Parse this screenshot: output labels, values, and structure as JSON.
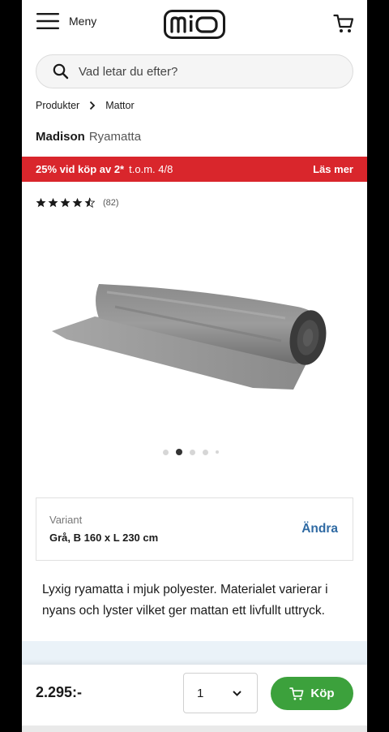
{
  "header": {
    "menu_label": "Meny",
    "logo_text": "mio",
    "icons": [
      "hamburger-menu-icon",
      "cart-icon"
    ]
  },
  "search": {
    "placeholder": "Vad letar du efter?",
    "icon": "search-icon"
  },
  "breadcrumb": {
    "items": [
      "Produkter",
      "Mattor"
    ]
  },
  "product": {
    "brand": "Madison",
    "subtitle": "Ryamatta",
    "rating_stars": 4.5,
    "rating_max": 5,
    "rating_count": "(82)",
    "image_count": 5,
    "active_image": 2,
    "description": "Lyxig ryamatta i mjuk polyester. Materialet varierar i nyans och lyster vilket ger mattan ett livfullt uttryck."
  },
  "promo": {
    "deal": "25% vid köp av 2*",
    "until": "t.o.m. 4/8",
    "link": "Läs mer",
    "color": "#d9262c"
  },
  "variant": {
    "label": "Variant",
    "value": "Grå, B 160 x L 230 cm",
    "change": "Ändra"
  },
  "purchase": {
    "price": "2.295:-",
    "quantity": "1",
    "buy_label": "Köp",
    "buy_color": "#3ca13c"
  }
}
